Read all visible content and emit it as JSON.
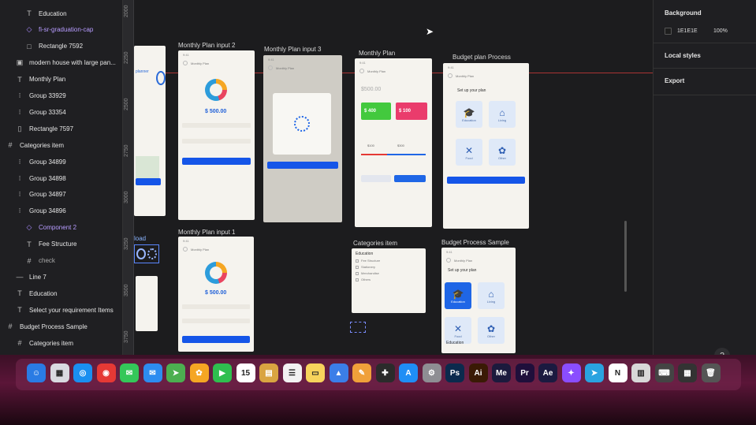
{
  "layers": [
    {
      "icon": "text-icon",
      "glyph": "T",
      "label": "Education",
      "indent": 1,
      "style": ""
    },
    {
      "icon": "component-instance-icon",
      "glyph": "◇",
      "label": "fi-sr-graduation-cap",
      "indent": 1,
      "style": "purple"
    },
    {
      "icon": "rectangle-icon",
      "glyph": "□",
      "label": "Rectangle 7592",
      "indent": 1,
      "style": ""
    },
    {
      "icon": "image-icon",
      "glyph": "▣",
      "label": "modern house with large pan...",
      "indent": 0,
      "style": ""
    },
    {
      "icon": "text-icon",
      "glyph": "T",
      "label": "Monthly Plan",
      "indent": 0,
      "style": ""
    },
    {
      "icon": "group-icon",
      "glyph": "⁝",
      "label": "Group 33929",
      "indent": 0,
      "style": ""
    },
    {
      "icon": "group-icon",
      "glyph": "⁝",
      "label": "Group 33354",
      "indent": 0,
      "style": ""
    },
    {
      "icon": "rectangle-icon",
      "glyph": "▯",
      "label": "Rectangle 7597",
      "indent": 0,
      "style": ""
    },
    {
      "icon": "frame-icon",
      "glyph": "#",
      "label": "Categories item",
      "indent": -1,
      "style": ""
    },
    {
      "icon": "group-icon",
      "glyph": "⁝",
      "label": "Group 34899",
      "indent": 0,
      "style": ""
    },
    {
      "icon": "group-icon",
      "glyph": "⁝",
      "label": "Group 34898",
      "indent": 0,
      "style": ""
    },
    {
      "icon": "group-icon",
      "glyph": "⁝",
      "label": "Group 34897",
      "indent": 0,
      "style": ""
    },
    {
      "icon": "group-icon",
      "glyph": "⁝",
      "label": "Group 34896",
      "indent": 0,
      "style": ""
    },
    {
      "icon": "component-instance-icon",
      "glyph": "◇",
      "label": "Component 2",
      "indent": 1,
      "style": "purple"
    },
    {
      "icon": "text-icon",
      "glyph": "T",
      "label": "Fee Structure",
      "indent": 1,
      "style": ""
    },
    {
      "icon": "frame-icon",
      "glyph": "#",
      "label": "check",
      "indent": 1,
      "style": "dim"
    },
    {
      "icon": "line-icon",
      "glyph": "—",
      "label": "Line 7",
      "indent": 0,
      "style": ""
    },
    {
      "icon": "text-icon",
      "glyph": "T",
      "label": "Education",
      "indent": 0,
      "style": ""
    },
    {
      "icon": "text-icon",
      "glyph": "T",
      "label": "Select your requirement Items",
      "indent": 0,
      "style": ""
    },
    {
      "icon": "frame-icon",
      "glyph": "#",
      "label": "Budget Process Sample",
      "indent": -1,
      "style": ""
    },
    {
      "icon": "frame-icon",
      "glyph": "#",
      "label": "Categories item",
      "indent": 0,
      "style": ""
    }
  ],
  "ruler": [
    "2000",
    "2250",
    "2500",
    "2750",
    "3000",
    "3250",
    "3500",
    "3750"
  ],
  "frames": {
    "f1_label": "Monthly Plan input 2",
    "f2_label": "Monthly Plan input 3",
    "f3_label": "Monthly Plan",
    "f4_label": "Budget plan Process",
    "f5_label": "Monthly Plan input 1",
    "f6_label": "Categories item",
    "f7_label": "Budget Process Sample",
    "load_label": "load",
    "planner_label": "planner",
    "amount1": "$ 500.00",
    "amount2": "$ 500.00",
    "amount3": "$500.00",
    "card_green": "$ 400",
    "card_red": "$ 100",
    "slider_left": "$100",
    "slider_right": "$300",
    "setup_title": "Set up your plan",
    "setup_title2": "Set up your plan",
    "edu_title": "Education",
    "edu_title2": "Education",
    "tiles": [
      "Education",
      "Living",
      "Food",
      "Other"
    ],
    "cat_items": [
      "Fee Structure",
      "Stationery",
      "Merchandise",
      "Others"
    ]
  },
  "props": {
    "background_title": "Background",
    "background_hex": "1E1E1E",
    "background_opacity": "100%",
    "local_styles": "Local styles",
    "export": "Export",
    "help": "?"
  },
  "dock": {
    "apps": [
      {
        "name": "finder-icon",
        "color": "#2a7be4",
        "glyph": "☺"
      },
      {
        "name": "launchpad-icon",
        "color": "#d9d9e0",
        "glyph": "▦"
      },
      {
        "name": "safari-icon",
        "color": "#1a8ff0",
        "glyph": "◎"
      },
      {
        "name": "chrome-icon",
        "color": "#e53935",
        "glyph": "◉"
      },
      {
        "name": "messages-icon",
        "color": "#34c759",
        "glyph": "✉"
      },
      {
        "name": "mail-icon",
        "color": "#2d8cf0",
        "glyph": "✉"
      },
      {
        "name": "maps-icon",
        "color": "#4caf50",
        "glyph": "➤"
      },
      {
        "name": "photos-icon",
        "color": "#f5a623",
        "glyph": "✿"
      },
      {
        "name": "facetime-icon",
        "color": "#2fbf4f",
        "glyph": "▶"
      },
      {
        "name": "calendar-icon",
        "color": "#ffffff",
        "glyph": "15"
      },
      {
        "name": "notes-app-icon",
        "color": "#d9a441",
        "glyph": "▤"
      },
      {
        "name": "reminders-icon",
        "color": "#f2f2f2",
        "glyph": "☰"
      },
      {
        "name": "notes-icon",
        "color": "#f7d35c",
        "glyph": "▭"
      },
      {
        "name": "keynote-icon",
        "color": "#3b7ee8",
        "glyph": "▲"
      },
      {
        "name": "pages-icon",
        "color": "#f0a03a",
        "glyph": "✎"
      },
      {
        "name": "figma-icon",
        "color": "#2b2b2b",
        "glyph": "✚"
      },
      {
        "name": "app-store-icon",
        "color": "#1f8ef5",
        "glyph": "A"
      },
      {
        "name": "system-settings-icon",
        "color": "#8e8e93",
        "glyph": "⚙"
      },
      {
        "name": "photoshop-icon",
        "color": "#0b2a4d",
        "glyph": "Ps"
      },
      {
        "name": "illustrator-icon",
        "color": "#3a1a05",
        "glyph": "Ai"
      },
      {
        "name": "media-encoder-icon",
        "color": "#1c1a3d",
        "glyph": "Me"
      },
      {
        "name": "premiere-icon",
        "color": "#1f0f3b",
        "glyph": "Pr"
      },
      {
        "name": "after-effects-icon",
        "color": "#1b1a40",
        "glyph": "Ae"
      },
      {
        "name": "messenger-icon",
        "color": "#8a4dff",
        "glyph": "✦"
      },
      {
        "name": "telegram-icon",
        "color": "#2aa3e0",
        "glyph": "➤"
      },
      {
        "name": "notion-icon",
        "color": "#ffffff",
        "glyph": "N"
      },
      {
        "name": "preview-icon",
        "color": "#d8d8d8",
        "glyph": "▥"
      },
      {
        "name": "keyboard-viewer-icon",
        "color": "#444",
        "glyph": "⌨"
      },
      {
        "name": "screenshot-icon",
        "color": "#333",
        "glyph": "▦"
      },
      {
        "name": "trash-icon",
        "color": "#555",
        "glyph": "🗑"
      }
    ]
  }
}
